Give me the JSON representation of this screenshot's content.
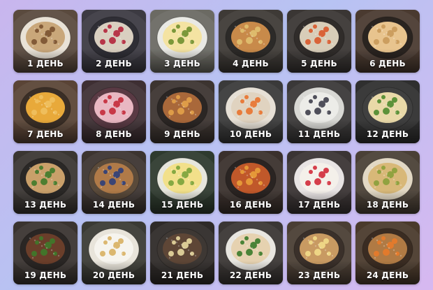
{
  "days": [
    {
      "label": "1 ДЕНЬ",
      "dish": "oatmeal-bowl",
      "bg": "#5a4a3e",
      "plate": "#e9e2d6",
      "food": "#c9a77a",
      "accent": "#7a5230"
    },
    {
      "label": "2 ДЕНЬ",
      "dish": "berry-porridge",
      "bg": "#3c3a42",
      "plate": "#2f2e35",
      "food": "#d9cfc0",
      "accent": "#b3243b"
    },
    {
      "label": "3 ДЕНЬ",
      "dish": "avocado-eggs",
      "bg": "#6b6a63",
      "plate": "#e9e9e4",
      "food": "#f4e3a2",
      "accent": "#6f8f2f"
    },
    {
      "label": "4 ДЕНЬ",
      "dish": "chicken-vegetables",
      "bg": "#3e3a36",
      "plate": "#2c2a28",
      "food": "#c88a4a",
      "accent": "#e0c070"
    },
    {
      "label": "5 ДЕНЬ",
      "dish": "rice-vegetables",
      "bg": "#3a3634",
      "plate": "#302c2a",
      "food": "#d8cdb8",
      "accent": "#d9582a"
    },
    {
      "label": "6 ДЕНЬ",
      "dish": "crisps",
      "bg": "#4a3a30",
      "plate": "#2a2420",
      "food": "#e8c48e",
      "accent": "#c99a5a"
    },
    {
      "label": "7 ДЕНЬ",
      "dish": "pumpkin-porridge",
      "bg": "#5a4436",
      "plate": "#3a2e26",
      "food": "#e8a93a",
      "accent": "#f0c060"
    },
    {
      "label": "8 ДЕНЬ",
      "dish": "berry-smoothie",
      "bg": "#3e2f33",
      "plate": "#5a3a44",
      "food": "#e9b7c2",
      "accent": "#c42a3a"
    },
    {
      "label": "9 ДЕНЬ",
      "dish": "stew-bowl",
      "bg": "#3c3430",
      "plate": "#2b2624",
      "food": "#a9683a",
      "accent": "#e3a24a"
    },
    {
      "label": "10 ДЕНЬ",
      "dish": "carrot-dip",
      "bg": "#3a3a3a",
      "plate": "#e6e0d6",
      "food": "#e0d3c0",
      "accent": "#e9722e"
    },
    {
      "label": "11 ДЕНЬ",
      "dish": "yogurt-bowl",
      "bg": "#3a3838",
      "plate": "#d8d8d4",
      "food": "#ecece8",
      "accent": "#3e3e4a"
    },
    {
      "label": "12 ДЕНЬ",
      "dish": "fish-potatoes",
      "bg": "#2f2f2f",
      "plate": "#404040",
      "food": "#e9d9a8",
      "accent": "#4e8a2c"
    },
    {
      "label": "13 ДЕНЬ",
      "dish": "chicken-broccoli",
      "bg": "#3a3632",
      "plate": "#2a2826",
      "food": "#c9a06a",
      "accent": "#3f7a2a"
    },
    {
      "label": "14 ДЕНЬ",
      "dish": "nuts-berries",
      "bg": "#3c3430",
      "plate": "#5a4a3a",
      "food": "#b07a48",
      "accent": "#2e3e7a"
    },
    {
      "label": "15 ДЕНЬ",
      "dish": "stuffed-eggs",
      "bg": "#2e3a2e",
      "plate": "#e6e6dc",
      "food": "#f2e08a",
      "accent": "#7aa33a"
    },
    {
      "label": "16 ДЕНЬ",
      "dish": "vegetable-stew",
      "bg": "#3a302c",
      "plate": "#2a2422",
      "food": "#c0582a",
      "accent": "#e9a03a"
    },
    {
      "label": "17 ДЕНЬ",
      "dish": "cottage-berries",
      "bg": "#3a3434",
      "plate": "#e8e4e4",
      "food": "#f4f0ea",
      "accent": "#d22a3a"
    },
    {
      "label": "18 ДЕНЬ",
      "dish": "baked-casserole",
      "bg": "#4a4036",
      "plate": "#e2d8c4",
      "food": "#d8b878",
      "accent": "#8aa03a"
    },
    {
      "label": "19 ДЕНЬ",
      "dish": "beef-mash",
      "bg": "#3a3430",
      "plate": "#2a2624",
      "food": "#6a3e2a",
      "accent": "#3e7a2a"
    },
    {
      "label": "20 ДЕНЬ",
      "dish": "cottage-cheese",
      "bg": "#3a3a34",
      "plate": "#e8e4da",
      "food": "#f6f4ee",
      "accent": "#d8b060"
    },
    {
      "label": "21 ДЕНЬ",
      "dish": "energy-balls",
      "bg": "#2e2a28",
      "plate": "#3e3834",
      "food": "#5e4636",
      "accent": "#e8d8a0"
    },
    {
      "label": "22 ДЕНЬ",
      "dish": "chicken-fillet",
      "bg": "#3a3634",
      "plate": "#e8e6e0",
      "food": "#e6d2b0",
      "accent": "#3a7a2a"
    },
    {
      "label": "23 ДЕНЬ",
      "dish": "banana-oatmeal",
      "bg": "#4a3e34",
      "plate": "#3a302a",
      "food": "#c89a62",
      "accent": "#f2dc8a"
    },
    {
      "label": "24 ДЕНЬ",
      "dish": "dried-fruits-nuts",
      "bg": "#4a3a2c",
      "plate": "#3a2c22",
      "food": "#b07a44",
      "accent": "#e87a2a"
    }
  ]
}
